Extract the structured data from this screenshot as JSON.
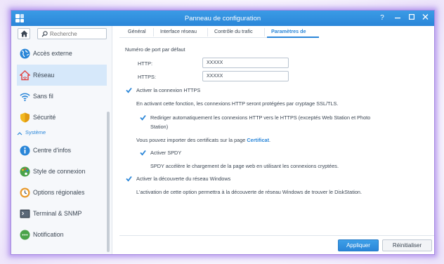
{
  "window": {
    "title": "Panneau de configuration",
    "help_icon": "question-icon",
    "minimize_icon": "minimize-icon",
    "maximize_icon": "maximize-icon",
    "close_icon": "close-icon",
    "accent_color": "#2a86d8"
  },
  "sidebar": {
    "search_placeholder": "Recherche",
    "items": [
      {
        "label": "Accès externe",
        "icon": "globe-icon"
      },
      {
        "label": "Réseau",
        "icon": "home-network-icon"
      },
      {
        "label": "Sans fil",
        "icon": "wifi-icon"
      },
      {
        "label": "Sécurité",
        "icon": "shield-icon"
      }
    ],
    "section": "Système",
    "system_items": [
      {
        "label": "Centre d'infos",
        "icon": "info-icon"
      },
      {
        "label": "Style de connexion",
        "icon": "palette-icon"
      },
      {
        "label": "Options régionales",
        "icon": "clock-icon"
      },
      {
        "label": "Terminal & SNMP",
        "icon": "terminal-icon"
      },
      {
        "label": "Notification",
        "icon": "chat-icon"
      }
    ]
  },
  "tabs": [
    {
      "label": "Général"
    },
    {
      "label": "Interface réseau"
    },
    {
      "label": "Contrôle du trafic"
    },
    {
      "label": "Paramètres de"
    }
  ],
  "content": {
    "port_heading": "Numéro de port par défaut",
    "http_label": "HTTP:",
    "http_value": "XXXXX",
    "https_label": "HTTPS:",
    "https_value": "XXXXX",
    "enable_https": "Activer la connexion HTTPS",
    "enable_https_desc": "En activant cette fonction, les connexions HTTP seront protégées par cryptage SSL/TLS.",
    "redirect_line1": "Rediriger automatiquement les connexions HTTP vers le HTTPS (exceptés Web Station et Photo",
    "redirect_line2": "Station)",
    "cert_text": "Vous pouvez importer des certificats sur la page",
    "cert_link": "Certificat",
    "cert_end": ".",
    "enable_spdy": "Activer SPDY",
    "spdy_desc": "SPDY accélère le chargement de la page web en utilisant les connexions cryptées.",
    "enable_discovery": "Activer la découverte du réseau Windows",
    "discovery_desc": "L'activation de cette option permettra à la découverte de réseau Windows de trouver le DiskStation."
  },
  "footer": {
    "apply": "Appliquer",
    "reset": "Réinitialiser"
  }
}
